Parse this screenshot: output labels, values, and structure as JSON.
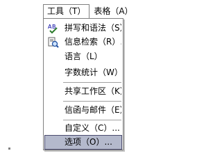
{
  "menubar": {
    "items": [
      {
        "label": "工具（T）",
        "state": "open"
      },
      {
        "label": "表格（A）",
        "state": "closed"
      }
    ]
  },
  "dropdown": {
    "items": [
      {
        "label": "拼写和语法（S）...",
        "icon": "spelling-grammar-icon"
      },
      {
        "label": "信息检索（R）...",
        "icon": "research-icon"
      },
      {
        "label": "语言（L）"
      },
      {
        "label": "字数统计（W）..."
      },
      {
        "label": "共享工作区（K）..."
      },
      {
        "label": "信函与邮件（E）"
      },
      {
        "label": "自定义（C）..."
      },
      {
        "label": "选项（O）...",
        "selected": true
      }
    ]
  },
  "colors": {
    "selected_bg": "#b4b9cc",
    "selected_border": "#4b4b6f",
    "border": "#808080"
  }
}
